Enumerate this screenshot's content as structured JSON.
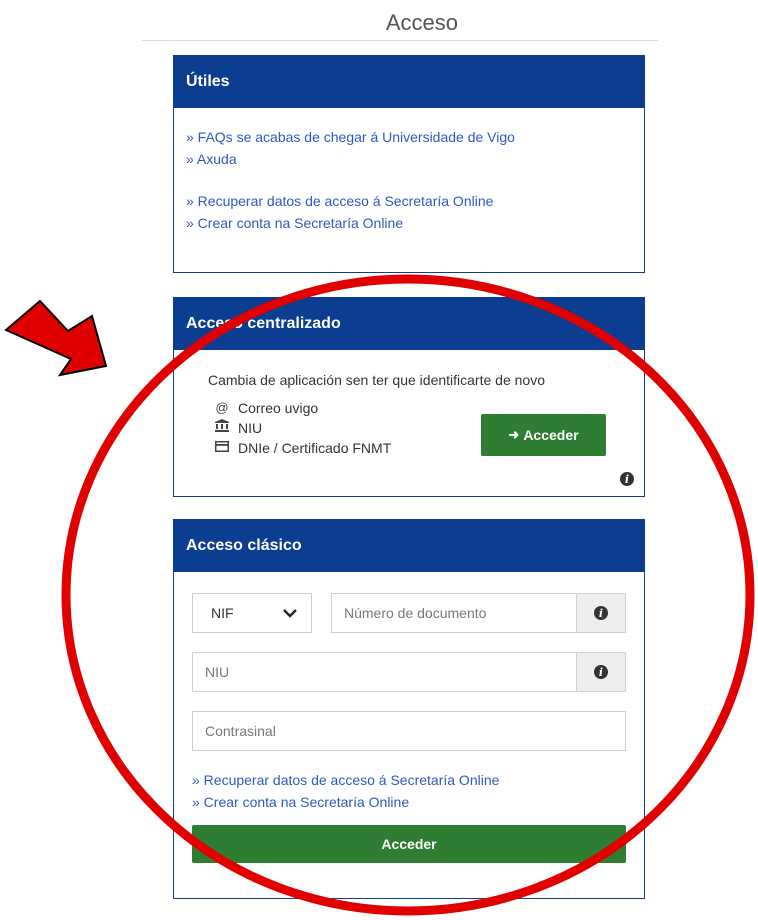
{
  "page": {
    "title": "Acceso"
  },
  "utiles": {
    "header": "Útiles",
    "links": [
      "» FAQs se acabas de chegar á Universidade de Vigo",
      "» Axuda",
      "» Recuperar datos de acceso á Secretaría Online",
      "» Crear conta na Secretaría Online"
    ]
  },
  "central": {
    "header": "Acceso centralizado",
    "description": "Cambia de aplicación sen ter que identificarte de novo",
    "methods": [
      {
        "icon": "at-icon",
        "label": "Correo uvigo"
      },
      {
        "icon": "institution-icon",
        "label": "NIU"
      },
      {
        "icon": "id-card-icon",
        "label": "DNIe / Certificado FNMT"
      }
    ],
    "button_label": "Acceder"
  },
  "clasico": {
    "header": "Acceso clásico",
    "doc_type_selected": "NIF",
    "doc_number_placeholder": "Número de documento",
    "niu_placeholder": "NIU",
    "password_placeholder": "Contrasinal",
    "links": [
      "» Recuperar datos de acceso á Secretaría Online",
      "» Crear conta na Secretaría Online"
    ],
    "button_label": "Acceder"
  },
  "colors": {
    "header_blue": "#0b3d91",
    "link_blue": "#2f58c3",
    "button_green": "#2e7d32",
    "annotation_red": "#e00000"
  }
}
